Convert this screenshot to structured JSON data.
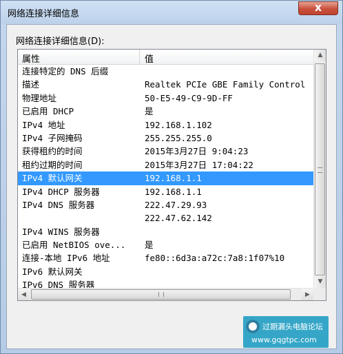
{
  "window": {
    "title": "网络连接详细信息",
    "close_label": "x"
  },
  "section_label": "网络连接详细信息(D):",
  "columns": [
    "属性",
    "值"
  ],
  "rows": [
    {
      "property": "连接特定的 DNS 后缀",
      "value": ""
    },
    {
      "property": "描述",
      "value": "Realtek PCIe GBE Family Control"
    },
    {
      "property": "物理地址",
      "value": "50-E5-49-C9-9D-FF"
    },
    {
      "property": "已启用 DHCP",
      "value": "是"
    },
    {
      "property": "IPv4 地址",
      "value": "192.168.1.102"
    },
    {
      "property": "IPv4 子网掩码",
      "value": "255.255.255.0"
    },
    {
      "property": "获得租约的时间",
      "value": "2015年3月27日 9:04:23"
    },
    {
      "property": "租约过期的时间",
      "value": "2015年3月27日 17:04:22"
    },
    {
      "property": "IPv4 默认网关",
      "value": "192.168.1.1"
    },
    {
      "property": "IPv4 DHCP 服务器",
      "value": "192.168.1.1"
    },
    {
      "property": "IPv4 DNS 服务器",
      "value": "222.47.29.93"
    },
    {
      "property": "",
      "value": "222.47.62.142"
    },
    {
      "property": "IPv4 WINS 服务器",
      "value": ""
    },
    {
      "property": "已启用 NetBIOS ove...",
      "value": "是"
    },
    {
      "property": "连接-本地 IPv6 地址",
      "value": "fe80::6d3a:a72c:7a8:1f07%10"
    },
    {
      "property": "IPv6 默认网关",
      "value": ""
    },
    {
      "property": "IPv6 DNS 服务器",
      "value": ""
    }
  ],
  "selected_row": 8,
  "scroll_arrows": {
    "up": "▲",
    "down": "▼",
    "left": "◀",
    "right": "▶"
  },
  "watermark": {
    "text": "过期漏头电脑论坛",
    "url": "www.gqgtpc.com"
  },
  "colors": {
    "selection": "#3399ff",
    "close_button": "#c9503d",
    "watermark_bg": "#36a6c8"
  }
}
